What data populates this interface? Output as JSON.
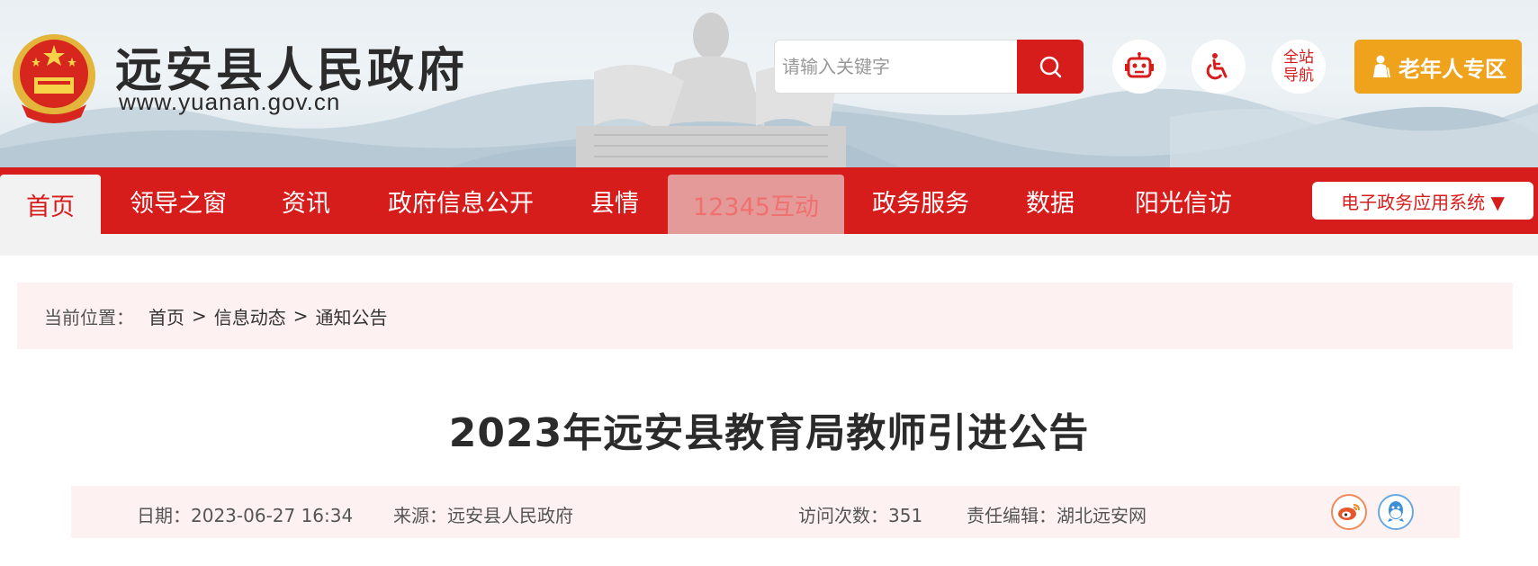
{
  "header": {
    "site_name": "远安县人民政府",
    "site_url": "www.yuanan.gov.cn",
    "search_placeholder": "请输入关键字",
    "site_nav_line1": "全站",
    "site_nav_line2": "导航",
    "elder_label": "老年人专区"
  },
  "nav": {
    "items": [
      {
        "label": "首页"
      },
      {
        "label": "领导之窗"
      },
      {
        "label": "资讯"
      },
      {
        "label": "政府信息公开"
      },
      {
        "label": "县情"
      },
      {
        "label": "12345互动"
      },
      {
        "label": "政务服务"
      },
      {
        "label": "数据"
      },
      {
        "label": "阳光信访"
      }
    ],
    "system_label": "电子政务应用系统 ▼"
  },
  "breadcrumb": {
    "label": "当前位置：",
    "items": [
      "首页",
      "信息动态",
      "通知公告"
    ],
    "separator": ">"
  },
  "article": {
    "title": "2023年远安县教育局教师引进公告",
    "date": "日期：2023-06-27 16:34",
    "source": "来源：远安县人民政府",
    "visits": "访问次数：351",
    "editor": "责任编辑：湖北远安网"
  },
  "colors": {
    "primary_red": "#d71c1c",
    "elder_orange": "#efa21b",
    "breadcrumb_bg": "#fdf2f1",
    "hover_tab": "#e59a9a"
  },
  "icons": {
    "search": "search-icon",
    "robot": "robot-icon",
    "accessibility": "wheelchair-icon",
    "elder": "elder-person-icon",
    "weibo": "weibo-icon",
    "qq": "qq-icon"
  }
}
